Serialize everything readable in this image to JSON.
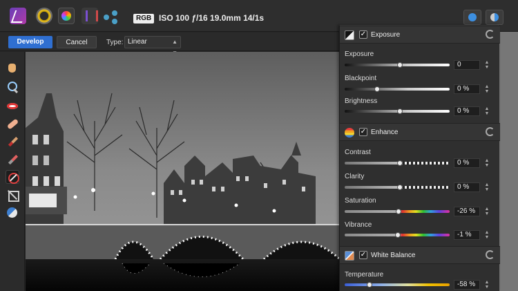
{
  "top_bar": {
    "personas": [
      {
        "name": "Photo Persona",
        "icon": "affinity-photo-icon"
      },
      {
        "name": "Liquify Persona",
        "icon": "liquify-icon"
      },
      {
        "name": "Develop Persona",
        "icon": "develop-icon"
      },
      {
        "name": "Tone Mapping Persona",
        "icon": "tone-mapping-icon"
      },
      {
        "name": "Export Persona",
        "icon": "export-icon"
      }
    ],
    "color_mode": "RGB",
    "exif": "ISO 100 ƒ/16 19.0mm 14/1s"
  },
  "context_bar": {
    "develop_label": "Develop",
    "cancel_label": "Cancel",
    "type_label": "Type:",
    "type_value": "Linear"
  },
  "tools": [
    "view-tool",
    "zoom-tool",
    "red-eye-tool",
    "blemish-removal-tool",
    "overlay-paint-tool",
    "overlay-erase-tool",
    "overlay-gradient-tool",
    "crop-tool",
    "white-balance-tool"
  ],
  "panel": {
    "exposure": {
      "title": "Exposure",
      "checked": "✓",
      "sliders": [
        {
          "label": "Exposure",
          "value": "0",
          "position": 0.5
        },
        {
          "label": "Blackpoint",
          "value": "0 %",
          "position": 0.3
        },
        {
          "label": "Brightness",
          "value": "0 %",
          "position": 0.5
        }
      ]
    },
    "enhance": {
      "title": "Enhance",
      "checked": "✓",
      "sliders": [
        {
          "label": "Contrast",
          "value": "0 %",
          "position": 0.5
        },
        {
          "label": "Clarity",
          "value": "0 %",
          "position": 0.5
        },
        {
          "label": "Saturation",
          "value": "-26 %",
          "position": 0.5
        },
        {
          "label": "Vibrance",
          "value": "-1 %",
          "position": 0.5
        }
      ]
    },
    "white_balance": {
      "title": "White Balance",
      "checked": "✓",
      "sliders": [
        {
          "label": "Temperature",
          "value": "-58 %",
          "position": 0.24
        }
      ]
    }
  },
  "colors": {
    "accent": "#2f6fd1",
    "panel_bg": "#2f2f2f",
    "toolbar_bg": "#2e2e2e"
  }
}
